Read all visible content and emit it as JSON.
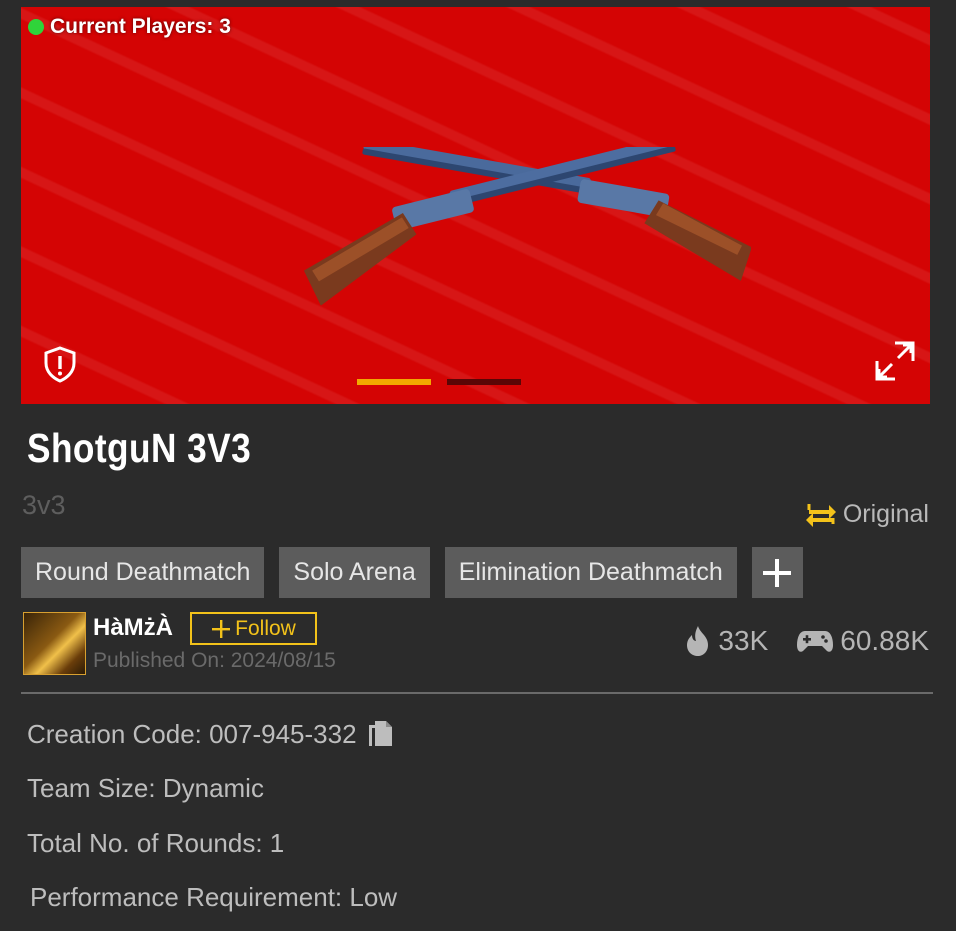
{
  "banner": {
    "players_label": "Current Players: 3",
    "carousel_active_index": 0,
    "carousel_count": 2,
    "colors": {
      "background": "#d40404",
      "indicator_active": "#f2a900",
      "indicator_inactive": "#5a0606",
      "online_dot": "#2fd43a"
    }
  },
  "map": {
    "title": "ShotguN 3V3",
    "subtitle": "3v3",
    "original_label": "Original"
  },
  "tags": [
    "Round Deathmatch",
    "Solo Arena",
    "Elimination Deathmatch"
  ],
  "author": {
    "name": "HàMżÀ",
    "follow_label": "Follow",
    "published": "Published On: 2024/08/15"
  },
  "stats": {
    "likes": "33K",
    "plays": "60.88K"
  },
  "details": {
    "creation_code": "Creation Code: 007-945-332",
    "team_size": "Team Size: Dynamic",
    "rounds": "Total No. of Rounds: 1",
    "performance": "Performance Requirement: Low"
  },
  "icons": [
    "online-dot-icon",
    "report-icon",
    "expand-icon",
    "original-swap-icon",
    "plus-icon",
    "fire-icon",
    "gamepad-icon",
    "copy-icon"
  ],
  "accent_color": "#f3c21a"
}
